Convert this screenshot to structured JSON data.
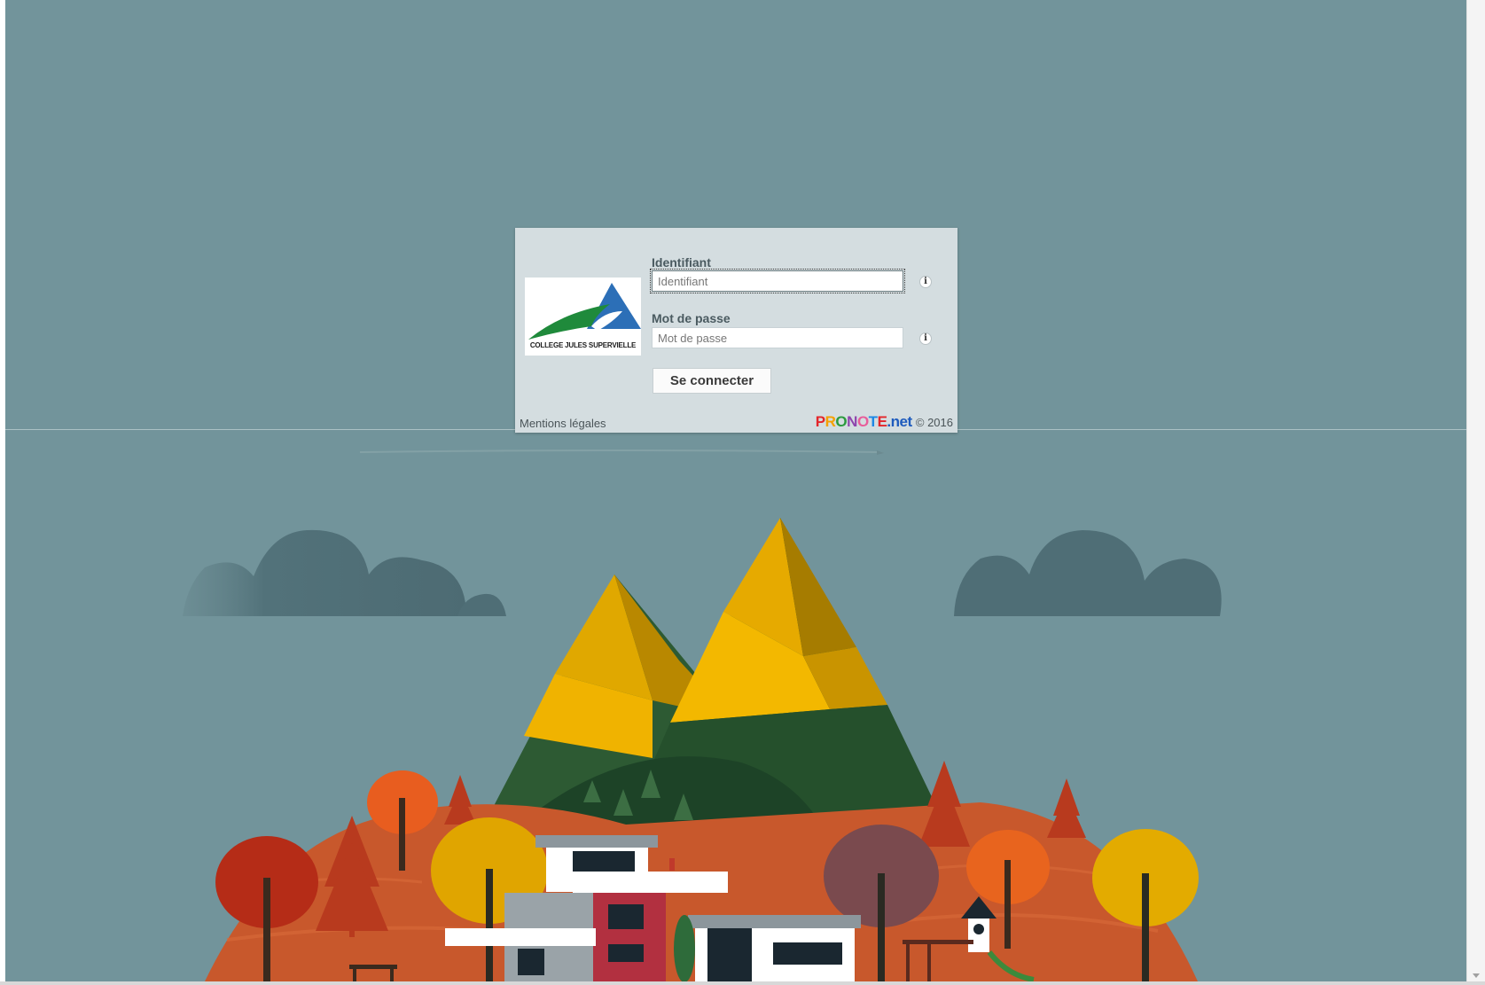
{
  "login": {
    "school_name": "COLLEGE JULES SUPERVIELLE",
    "username_label": "Identifiant",
    "username_placeholder": "Identifiant",
    "password_label": "Mot de passe",
    "password_placeholder": "Mot de passe",
    "submit_label": "Se connecter",
    "info_icon_glyph": "i"
  },
  "footer": {
    "legal_link": "Mentions légales",
    "brand_logo": "PRONOTE.net",
    "copyright": "© 2016"
  },
  "icons": {
    "info": "info-icon",
    "logo": "school-logo",
    "scroll_down": "scroll-down-arrow"
  },
  "colors": {
    "background": "#72949b",
    "panel": "#d4dde0",
    "logo_green": "#1f8a3b",
    "logo_blue": "#2c6fb7"
  }
}
